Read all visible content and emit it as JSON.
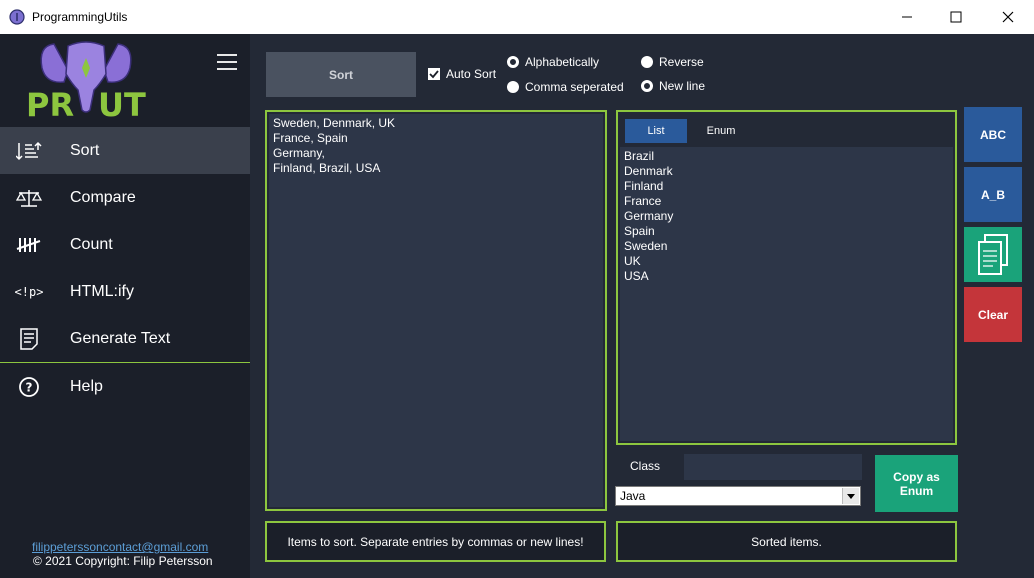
{
  "window": {
    "title": "ProgrammingUtils"
  },
  "sidebar": {
    "logo_text": "PRUT",
    "items": [
      {
        "label": "Sort",
        "icon": "sort-icon"
      },
      {
        "label": "Compare",
        "icon": "scale-icon"
      },
      {
        "label": "Count",
        "icon": "tally-icon"
      },
      {
        "label": "HTML:ify",
        "icon": "html-tag-icon",
        "glyph": "<!p>"
      },
      {
        "label": "Generate Text",
        "icon": "document-icon"
      },
      {
        "label": "Help",
        "icon": "help-icon"
      }
    ],
    "email": "filippeterssoncontact@gmail.com",
    "copyright": "© 2021 Copyright: Filip Petersson"
  },
  "toolbar": {
    "sort_label": "Sort",
    "auto_sort_label": "Auto Sort",
    "auto_sort_checked": true,
    "options": [
      {
        "label": "Alphabetically",
        "checked": false
      },
      {
        "label": "Reverse",
        "checked": true
      },
      {
        "label": "Comma seperated",
        "checked": true
      },
      {
        "label": "New line",
        "checked": false
      }
    ]
  },
  "input": {
    "text": "Sweden, Denmark, UK\nFrance, Spain\nGermany,\nFinland, Brazil, USA"
  },
  "output": {
    "tabs": [
      "List",
      "Enum"
    ],
    "active_tab": "List",
    "text": "Brazil\nDenmark\nFinland\nFrance\nGermany\nSpain\nSweden\nUK\nUSA"
  },
  "actions": {
    "abc_label": "ABC",
    "ab_label": "A_B",
    "copy_icon": "copy-icon",
    "clear_label": "Clear"
  },
  "enum": {
    "class_label": "Class",
    "class_value": "",
    "language": "Java",
    "copy_label": "Copy as\nEnum"
  },
  "status": {
    "left": "Items to sort. Separate entries by commas or new lines!",
    "right": "Sorted items."
  },
  "colors": {
    "accent_green": "#8dc63f",
    "sidebar_bg": "#1b1f29",
    "main_bg": "#232936",
    "blue_button": "#2a5a9b",
    "teal_button": "#1aa37a",
    "red_button": "#c4353a"
  }
}
